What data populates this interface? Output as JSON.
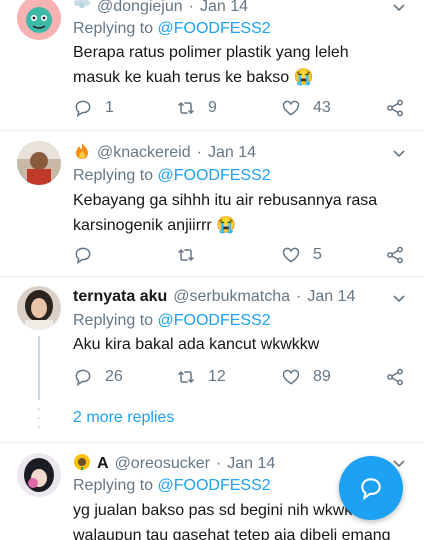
{
  "tweets": [
    {
      "name": "",
      "handle": "@dongiejun",
      "date": "Jan 14",
      "replying_prefix": "Replying to ",
      "replying_to": "@FOODFESS2",
      "text_lines": [
        "Berapa ratus polimer plastik yang leleh",
        "masuk ke kuah terus ke bakso 😭"
      ],
      "reply_count": "1",
      "retweet_count": "9",
      "like_count": "43"
    },
    {
      "name": "",
      "handle": "@knackereid",
      "date": "Jan 14",
      "replying_prefix": "Replying to ",
      "replying_to": "@FOODFESS2",
      "text_lines": [
        "Kebayang ga sihhh itu air rebusannya rasa",
        "karsinogenik anjiirrr 😭"
      ],
      "reply_count": "",
      "retweet_count": "",
      "like_count": "5"
    },
    {
      "name": "ternyata aku",
      "handle": "@serbukmatcha",
      "date": "Jan 14",
      "replying_prefix": "Replying to ",
      "replying_to": "@FOODFESS2",
      "text_lines": [
        "Aku kira bakal ada kancut wkwkkw"
      ],
      "reply_count": "26",
      "retweet_count": "12",
      "like_count": "89"
    },
    {
      "name": "A",
      "handle": "@oreosucker",
      "date": "Jan 14",
      "replying_prefix": "Replying to ",
      "replying_to": "@FOODFESS2",
      "text_lines": [
        "yg jualan bakso pas sd begini nih wkwk",
        "walaupun tau gasehat tetep aja dibeli emang"
      ]
    }
  ],
  "more_replies": "2 more replies",
  "dot": "·",
  "icons": {
    "reply": "reply-icon",
    "retweet": "retweet-icon",
    "like": "heart-icon",
    "share": "share-icon",
    "caret": "chevron-down-icon",
    "compose": "compose-reply-icon"
  },
  "colors": {
    "accent": "#1da1f2",
    "muted": "#657786",
    "text": "#14171a",
    "divider": "#e6ecf0"
  }
}
